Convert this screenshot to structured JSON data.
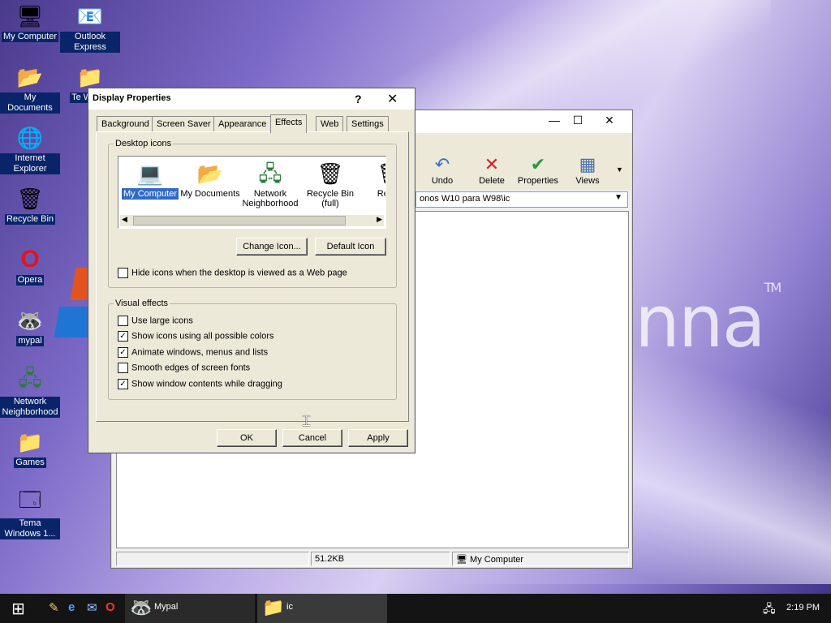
{
  "desktop": {
    "icons": [
      {
        "label": "My Computer",
        "glyph": "🖥"
      },
      {
        "label": "Outlook Express",
        "glyph": "📧"
      },
      {
        "label": "My Documents",
        "glyph": "📂"
      },
      {
        "label": "Te Windo",
        "glyph": "📁"
      },
      {
        "label": "Internet Explorer",
        "glyph": "🌐"
      },
      {
        "label": "Recycle Bin",
        "glyph": "🗑"
      },
      {
        "label": "Opera",
        "glyph": "O"
      },
      {
        "label": "mypal",
        "glyph": "🦝"
      },
      {
        "label": "Network Neighborhood",
        "glyph": "🖧"
      },
      {
        "label": "Games",
        "glyph": "📁"
      },
      {
        "label": "Tema Windows 1...",
        "glyph": "🗔"
      }
    ],
    "wallpaper_text": "enna",
    "wallpaper_tm": "TM"
  },
  "explorer": {
    "controls": {
      "minimize": "—",
      "maximize": "☐",
      "close": "✕"
    },
    "toolbar": [
      {
        "label": "Undo",
        "icon": "undo-icon",
        "glyph": "↶"
      },
      {
        "label": "Delete",
        "icon": "delete-icon",
        "glyph": "✕"
      },
      {
        "label": "Properties",
        "icon": "properties-icon",
        "glyph": "✔"
      },
      {
        "label": "Views",
        "icon": "views-icon",
        "glyph": "▦"
      }
    ],
    "address": "onos W10 para W98\\ic",
    "status": {
      "size": "51.2KB",
      "location": "My Computer"
    }
  },
  "dialog": {
    "title": "Display Properties",
    "help": "?",
    "close": "✕",
    "tabs": [
      "Background",
      "Screen Saver",
      "Appearance",
      "Effects",
      "Web",
      "Settings"
    ],
    "active_tab": "Effects",
    "desktop_icons": {
      "label": "Desktop icons",
      "items": [
        {
          "label": "My Computer",
          "glyph": "💻",
          "selected": true
        },
        {
          "label": "My Documents",
          "glyph": "📂",
          "selected": false
        },
        {
          "label": "Network Neighborhood",
          "glyph": "🖧",
          "selected": false
        },
        {
          "label": "Recycle Bin (full)",
          "glyph": "🗑",
          "selected": false
        },
        {
          "label": "Rec (e",
          "glyph": "🗑",
          "selected": false
        }
      ],
      "change_icon": "Change Icon...",
      "default_icon": "Default Icon",
      "hide_icons": {
        "label": "Hide icons when the desktop is viewed as a Web page",
        "checked": false
      }
    },
    "visual_effects": {
      "label": "Visual effects",
      "options": [
        {
          "label": "Use large icons",
          "checked": false
        },
        {
          "label": "Show icons using all possible colors",
          "checked": true
        },
        {
          "label": "Animate windows, menus and lists",
          "checked": true
        },
        {
          "label": "Smooth edges of screen fonts",
          "checked": false
        },
        {
          "label": "Show window contents while dragging",
          "checked": true
        }
      ]
    },
    "buttons": {
      "ok": "OK",
      "cancel": "Cancel",
      "apply": "Apply"
    }
  },
  "taskbar": {
    "start_glyph": "⊞",
    "quicklaunch": [
      {
        "name": "show-desktop-icon",
        "glyph": "✎"
      },
      {
        "name": "internet-explorer-icon",
        "glyph": "e"
      },
      {
        "name": "outlook-express-icon",
        "glyph": "✉"
      },
      {
        "name": "opera-icon",
        "glyph": "O"
      }
    ],
    "tasks": [
      {
        "label": "Mypal",
        "glyph": "🦝",
        "active": false
      },
      {
        "label": "ic",
        "glyph": "📁",
        "active": true
      }
    ],
    "clock": "2:19 PM"
  }
}
